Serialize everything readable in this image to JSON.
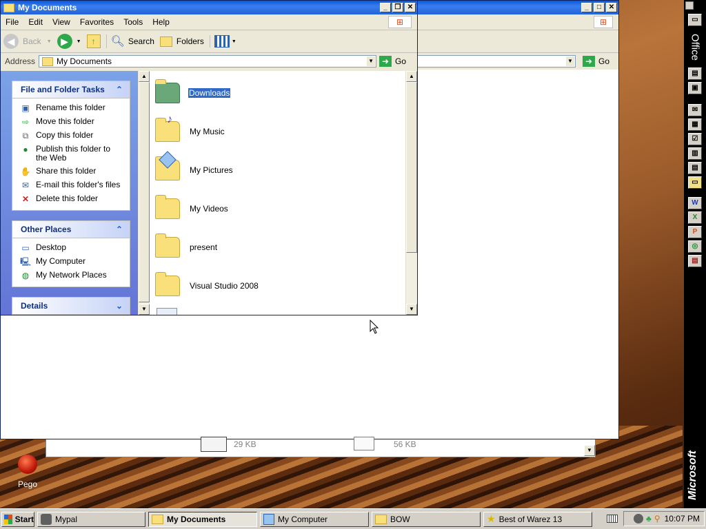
{
  "back_window": {
    "go_label": "Go",
    "files": [
      {
        "size": "29 KB"
      },
      {
        "size": "56 KB"
      }
    ]
  },
  "front_window": {
    "title": "My Documents",
    "menu": [
      "File",
      "Edit",
      "View",
      "Favorites",
      "Tools",
      "Help"
    ],
    "toolbar": {
      "back": "Back",
      "search": "Search",
      "folders": "Folders"
    },
    "address": {
      "label": "Address",
      "value": "My Documents",
      "go": "Go"
    },
    "tasks": {
      "file_folder": {
        "header": "File and Folder Tasks",
        "items": [
          "Rename this folder",
          "Move this folder",
          "Copy this folder",
          "Publish this folder to the Web",
          "Share this folder",
          "E-mail this folder's files",
          "Delete this folder"
        ]
      },
      "other_places": {
        "header": "Other Places",
        "items": [
          "Desktop",
          "My Computer",
          "My Network Places"
        ]
      },
      "details": {
        "header": "Details"
      }
    },
    "items": [
      "Downloads",
      "My Music",
      "My Pictures",
      "My Videos",
      "present",
      "Visual Studio 2008"
    ]
  },
  "desktop": {
    "icon_label": "Pego"
  },
  "office_bar": {
    "label": "Office",
    "brand": "Microsoft"
  },
  "taskbar": {
    "start": "Start",
    "buttons": [
      "Mypal",
      "My Documents",
      "My Computer",
      "BOW",
      "Best of Warez 13"
    ],
    "clock": "10:07 PM"
  },
  "colors": {
    "selection": "#316ac5",
    "title_blue": "#0a58d8",
    "go_green": "#2ea84a"
  }
}
